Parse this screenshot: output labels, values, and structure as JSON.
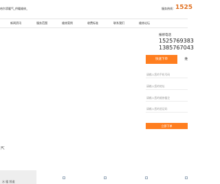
{
  "header": {
    "brand": "哈尔滨暖气_供暖维修_",
    "hotline_label": "服务热线：",
    "hotline": "1525"
  },
  "nav": {
    "items": [
      "新闻资讯",
      "服务范围",
      "维修案例",
      "收费标准",
      "联系我们",
      "维修论坛"
    ]
  },
  "contact": {
    "title": "报修电话",
    "phones": [
      "1525769383",
      "1385767043"
    ]
  },
  "form": {
    "tabs": [
      "快速下单",
      "维"
    ],
    "placeholders": [
      "请输入您的手机号码",
      "请输入您的地址",
      "请输入您的维修备注",
      "请输入您的验证码"
    ],
    "submit_label": "立即下单"
  },
  "footer": {
    "bottom_text": "水 暖 频道"
  }
}
